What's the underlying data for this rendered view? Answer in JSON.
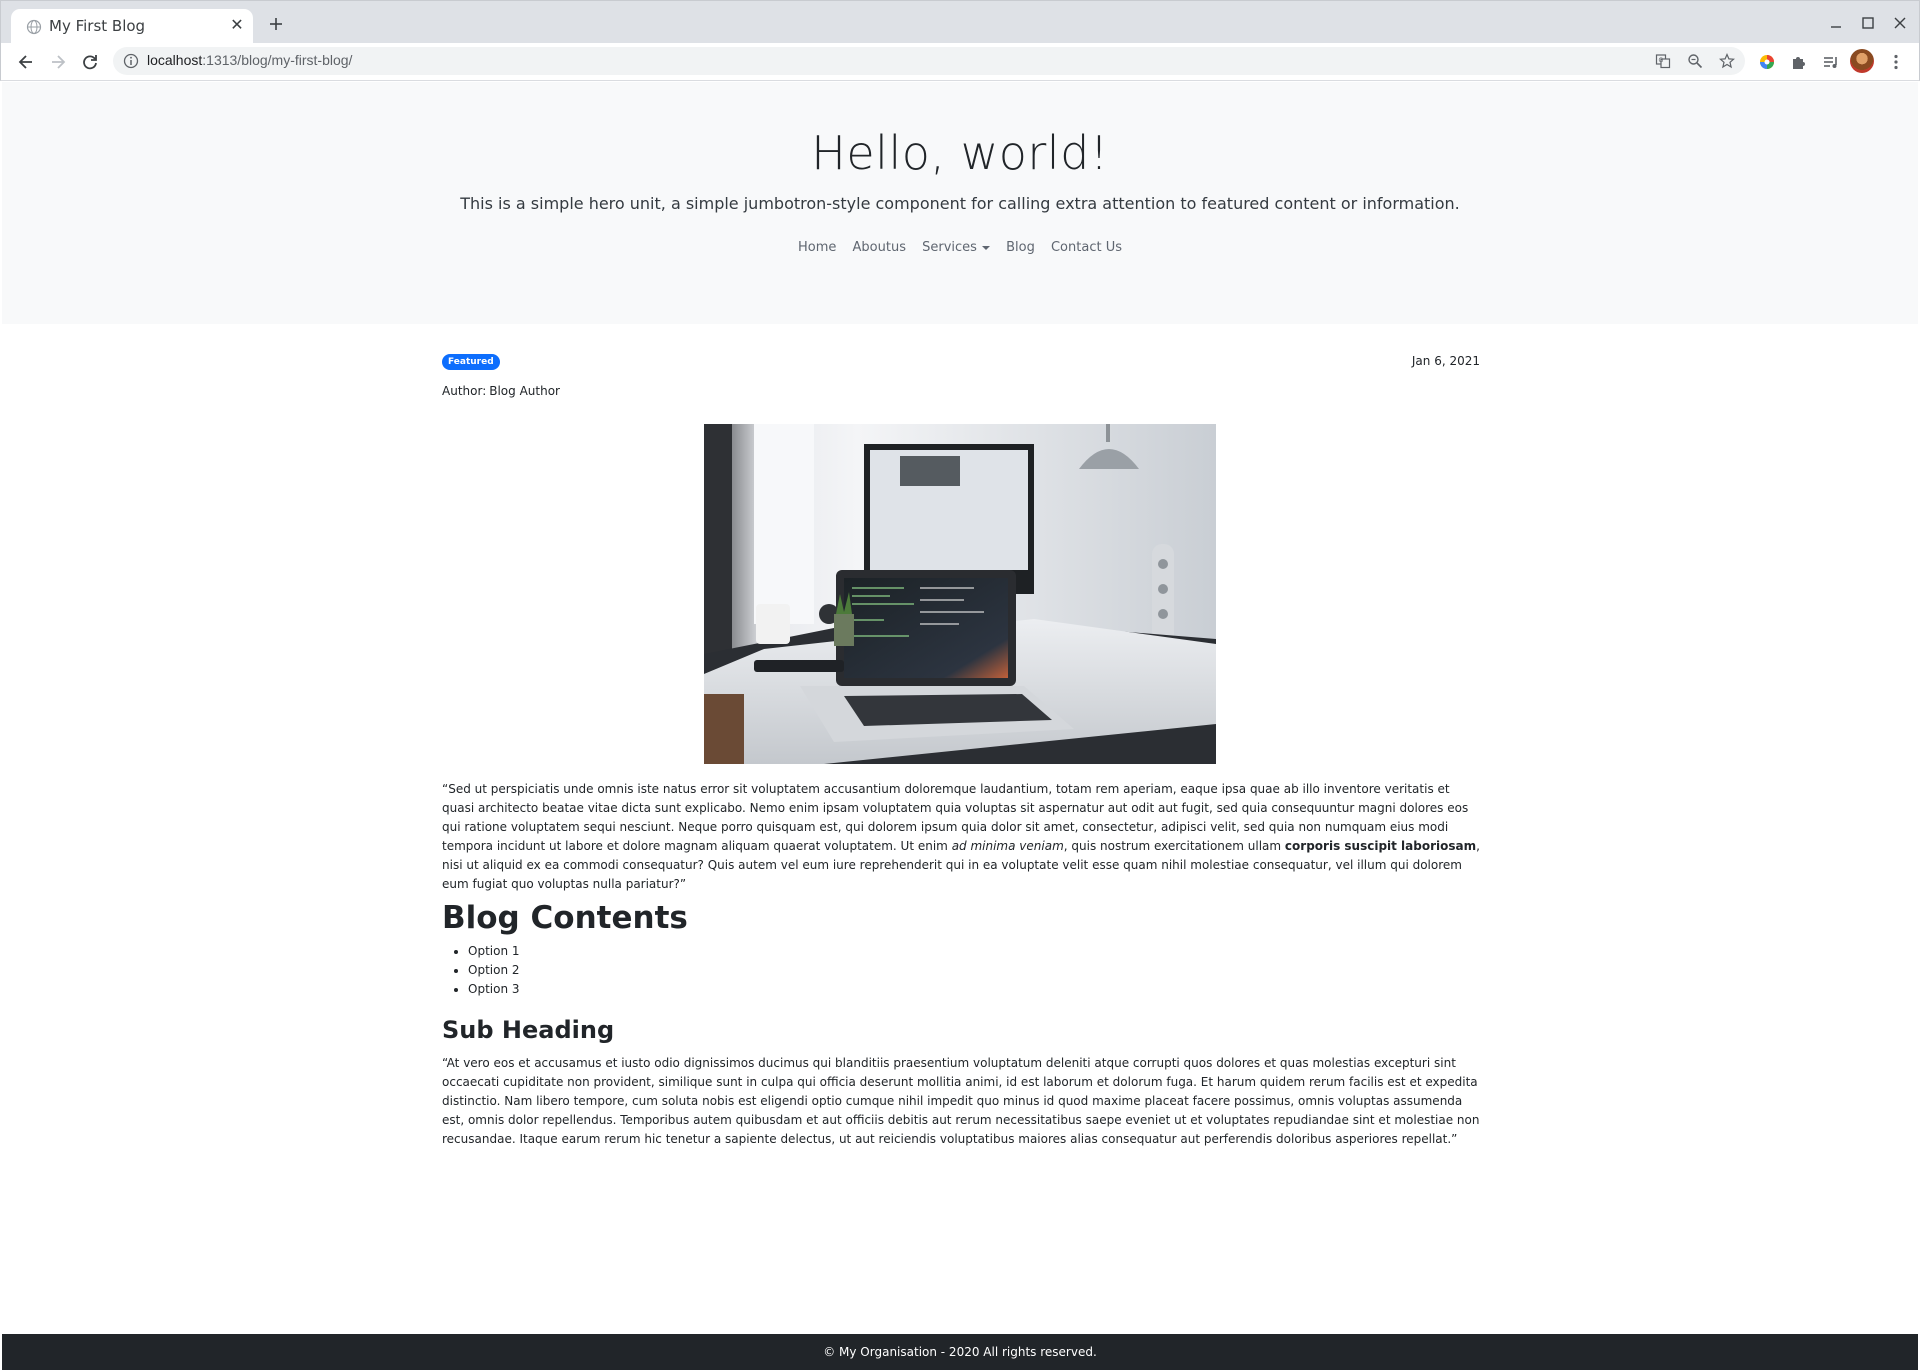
{
  "browser": {
    "tab_title": "My First Blog",
    "url_host": "localhost",
    "url_rest": ":1313/blog/my-first-blog/"
  },
  "hero": {
    "title": "Hello, world!",
    "lead": "This is a simple hero unit, a simple jumbotron-style component for calling extra attention to featured content or information."
  },
  "nav": {
    "items": [
      "Home",
      "Aboutus",
      "Services",
      "Blog",
      "Contact Us"
    ]
  },
  "post": {
    "badge": "Featured",
    "date": "Jan 6, 2021",
    "author_label": "Author:",
    "author_name": "Blog Author",
    "para1_a": "“Sed ut perspiciatis unde omnis iste natus error sit voluptatem accusantium doloremque laudantium, totam rem aperiam, eaque ipsa quae ab illo inventore veritatis et quasi architecto beatae vitae dicta sunt explicabo. Nemo enim ipsam voluptatem quia voluptas sit aspernatur aut odit aut fugit, sed quia consequuntur magni dolores eos qui ratione voluptatem sequi nesciunt. Neque porro quisquam est, qui dolorem ipsum quia dolor sit amet, consectetur, adipisci velit, sed quia non numquam eius modi tempora incidunt ut labore et dolore magnam aliquam quaerat voluptatem. Ut enim ",
    "para1_em": "ad minima veniam",
    "para1_b": ", quis nostrum exercitationem ullam ",
    "para1_strong": "corporis suscipit laboriosam",
    "para1_c": ", nisi ut aliquid ex ea commodi consequatur? Quis autem vel eum iure reprehenderit qui in ea voluptate velit esse quam nihil molestiae consequatur, vel illum qui dolorem eum fugiat quo voluptas nulla pariatur?”",
    "heading1": "Blog Contents",
    "list": [
      "Option 1",
      "Option 2",
      "Option 3"
    ],
    "heading2": "Sub Heading",
    "para2": "“At vero eos et accusamus et iusto odio dignissimos ducimus qui blanditiis praesentium voluptatum deleniti atque corrupti quos dolores et quas molestias excepturi sint occaecati cupiditate non provident, similique sunt in culpa qui officia deserunt mollitia animi, id est laborum et dolorum fuga. Et harum quidem rerum facilis est et expedita distinctio. Nam libero tempore, cum soluta nobis est eligendi optio cumque nihil impedit quo minus id quod maxime placeat facere possimus, omnis voluptas assumenda est, omnis dolor repellendus. Temporibus autem quibusdam et aut officiis debitis aut rerum necessitatibus saepe eveniet ut et voluptates repudiandae sint et molestiae non recusandae. Itaque earum rerum hic tenetur a sapiente delectus, ut aut reiciendis voluptatibus maiores alias consequatur aut perferendis doloribus asperiores repellat.”"
  },
  "footer": {
    "text": "© My Organisation - 2020 All rights reserved."
  },
  "colors": {
    "badge": "#0d6efd",
    "hero_bg": "#f8f9fa",
    "footer_bg": "#212529"
  }
}
